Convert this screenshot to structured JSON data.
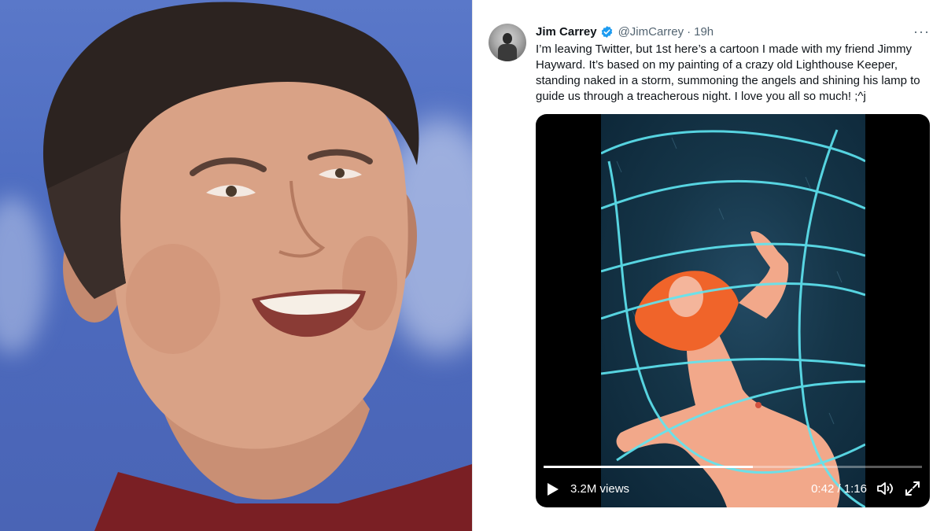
{
  "tweet": {
    "name": "Jim Carrey",
    "handle": "@JimCarrey",
    "separator": "·",
    "time": "19h",
    "more_label": "···",
    "text": "I’m leaving Twitter, but 1st here’s a cartoon I made with my friend Jimmy Hayward. It’s based on my painting of a crazy old Lighthouse Keeper, standing naked in a storm, summoning the angels and shining his lamp to guide us through a treacherous night. I love you all so much! ;^j"
  },
  "video": {
    "views": "3.2M views",
    "time_readout": "0:42 / 1:16",
    "progress_fraction": 0.553
  },
  "colors": {
    "verified": "#1d9bf0",
    "text_primary": "#0f1419",
    "text_secondary": "#536471",
    "photo_bg": "#4d6cc0",
    "storm_line": "#5fe6f2",
    "figure_skin": "#f2a88a",
    "figure_hair": "#f0642a"
  },
  "icons": {
    "verified": "verified-badge-icon",
    "more": "more-horizontal-icon",
    "play": "play-icon",
    "volume": "volume-icon",
    "fullscreen": "fullscreen-icon"
  }
}
